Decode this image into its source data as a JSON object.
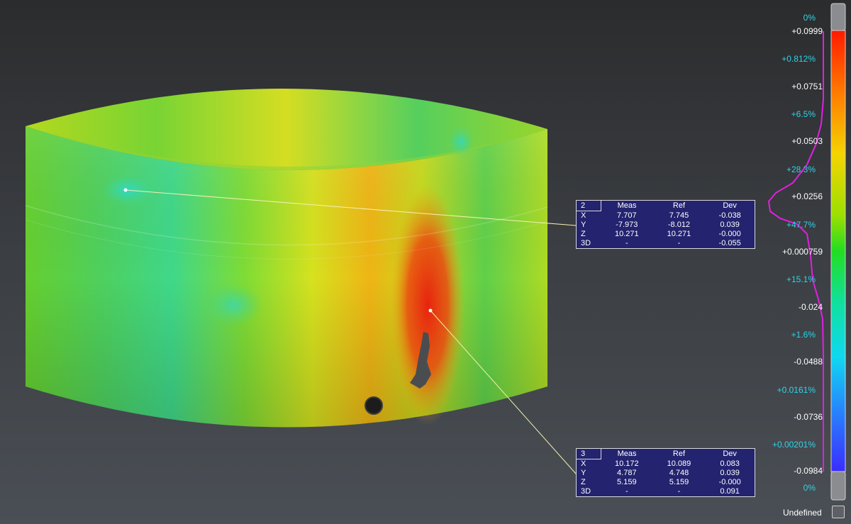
{
  "labels": [
    {
      "id": "2",
      "headers": [
        "Meas",
        "Ref",
        "Dev"
      ],
      "rows": [
        {
          "axis": "X",
          "meas": "7.707",
          "ref": "7.745",
          "dev": "-0.038"
        },
        {
          "axis": "Y",
          "meas": "-7.973",
          "ref": "-8.012",
          "dev": "0.039"
        },
        {
          "axis": "Z",
          "meas": "10.271",
          "ref": "10.271",
          "dev": "-0.000"
        },
        {
          "axis": "3D",
          "meas": "-",
          "ref": "-",
          "dev": "-0.055"
        }
      ]
    },
    {
      "id": "3",
      "headers": [
        "Meas",
        "Ref",
        "Dev"
      ],
      "rows": [
        {
          "axis": "X",
          "meas": "10.172",
          "ref": "10.089",
          "dev": "0.083"
        },
        {
          "axis": "Y",
          "meas": "4.787",
          "ref": "4.748",
          "dev": "0.039"
        },
        {
          "axis": "Z",
          "meas": "5.159",
          "ref": "5.159",
          "dev": "-0.000"
        },
        {
          "axis": "3D",
          "meas": "-",
          "ref": "-",
          "dev": "0.091"
        }
      ]
    }
  ],
  "legend": {
    "values": [
      "+0.0999",
      "+0.0751",
      "+0.0503",
      "+0.0256",
      "+0.000759",
      "-0.024",
      "-0.0488",
      "-0.0736",
      "-0.0984"
    ],
    "percents": [
      "0%",
      "+0.812%",
      "+6.5%",
      "+28.3%",
      "+47.7%",
      "+15.1%",
      "+1.6%",
      "+0.0161%",
      "+0.00201%",
      "0%"
    ],
    "undefined_label": "Undefined"
  },
  "colors": {
    "label_bg": "#23236f",
    "percent_text": "#2fd3e6",
    "histogram": "#e020e0",
    "leader_line": "#f3efb0"
  }
}
